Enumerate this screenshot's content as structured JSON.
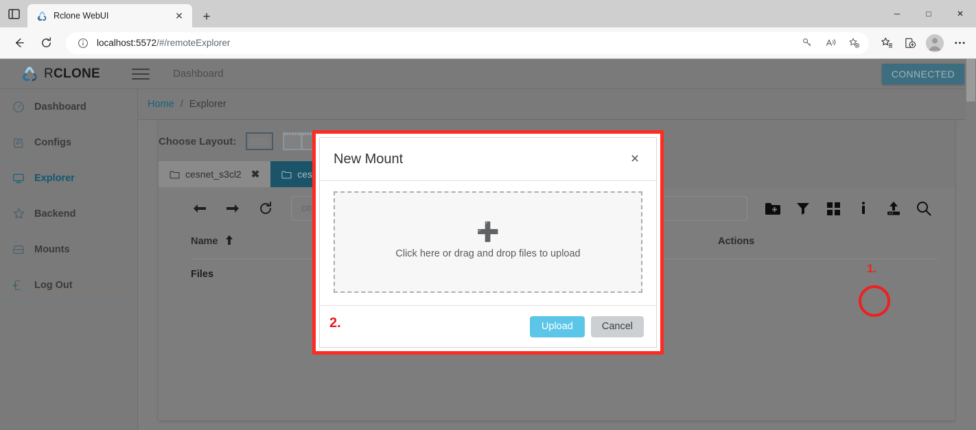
{
  "browser": {
    "tab": {
      "title": "Rclone WebUI",
      "favicon_icon": "rclone-favicon",
      "close_icon": "close-icon"
    },
    "new_tab_label": "+",
    "tab_list_icon": "tab-list-icon",
    "window_controls": {
      "minimize": "─",
      "maximize": "□",
      "close": "✕"
    },
    "nav": {
      "back_icon": "back-arrow-icon",
      "reload_icon": "reload-icon"
    },
    "omnibox": {
      "info_icon": "info-circle-icon",
      "url_host": "localhost:5572",
      "url_path": "/#/remoteExplorer",
      "full_url": "localhost:5572/#/remoteExplorer"
    },
    "toolbar_icons": [
      "key-icon",
      "read-aloud-icon",
      "add-favorite-icon",
      "favorites-icon",
      "collections-icon",
      "profile-avatar-icon",
      "settings-more-icon"
    ]
  },
  "app": {
    "brand_prefix": "R",
    "brand_suffix": "CLONE",
    "logo_icon": "rclone-logo-icon",
    "menu_icon": "hamburger-menu-icon",
    "title": "Dashboard",
    "connected_label": "CONNECTED",
    "connected_color": "#3c6e80"
  },
  "sidebar": {
    "items": [
      {
        "label": "Dashboard",
        "icon": "speedometer-icon",
        "active": false
      },
      {
        "label": "Configs",
        "icon": "edit-square-icon",
        "active": false
      },
      {
        "label": "Explorer",
        "icon": "monitor-icon",
        "active": true
      },
      {
        "label": "Backend",
        "icon": "star-icon",
        "active": false
      },
      {
        "label": "Mounts",
        "icon": "drive-icon",
        "active": false
      },
      {
        "label": "Log Out",
        "icon": "logout-icon",
        "active": false
      }
    ]
  },
  "breadcrumb": {
    "home": "Home",
    "separator": "/",
    "current": "Explorer"
  },
  "explorer": {
    "layout_label": "Choose Layout:",
    "layout_options": [
      "single-pane-layout-icon",
      "dual-pane-layout-icon"
    ],
    "tabs": [
      {
        "label": "cesnet_s3cl2",
        "icon": "folder-icon",
        "close": "✖",
        "active": false
      },
      {
        "label": "ces",
        "icon": "folder-icon",
        "active": true
      }
    ],
    "nav_icons": [
      "back-arrow-icon",
      "forward-arrow-icon",
      "refresh-icon"
    ],
    "path_value": "cesn",
    "right_icons": [
      "new-folder-icon",
      "filter-icon",
      "grid-view-icon",
      "info-icon",
      "upload-icon",
      "search-icon"
    ],
    "columns": {
      "name": "Name",
      "sort_icon": "sort-asc-arrow-icon",
      "actions": "Actions"
    },
    "files_label": "Files"
  },
  "modal": {
    "title": "New Mount",
    "close_icon": "close-icon",
    "dropzone": {
      "plus_icon": "plus-icon",
      "text": "Click here or drag and drop files to upload"
    },
    "upload_label": "Upload",
    "cancel_label": "Cancel",
    "upload_color": "#5bc6e8",
    "cancel_color": "#cdd0d2"
  },
  "annotations": {
    "step1": "1.",
    "step2": "2.",
    "color": "#ee2020"
  }
}
